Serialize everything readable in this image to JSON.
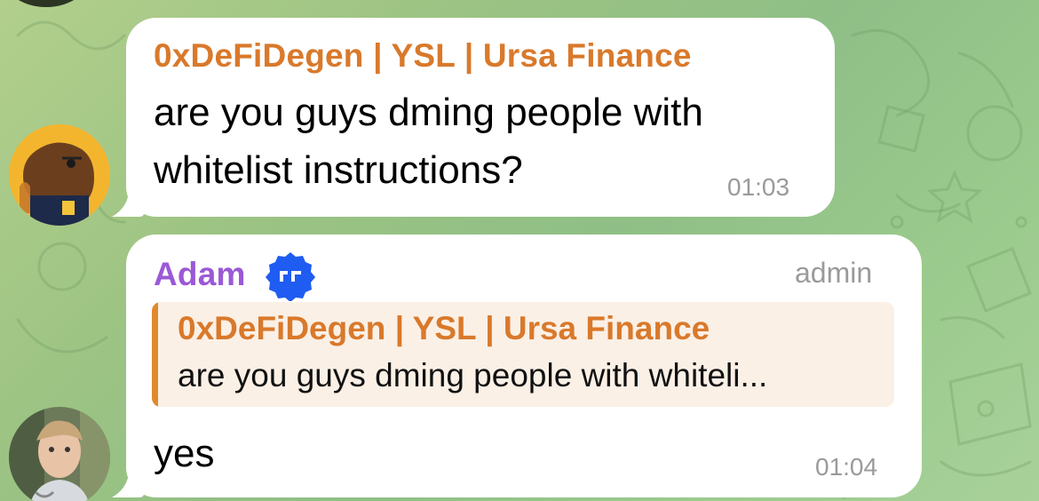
{
  "colors": {
    "sender_one_name": "#d9792b",
    "sender_two_name": "#9b59d6",
    "reply_bar": "#e08a2e",
    "verified_badge": "#1f5cf2",
    "timestamp": "#9a9a9a"
  },
  "messages": [
    {
      "sender": "0xDeFiDegen | YSL | Ursa Finance",
      "avatar_icon": "capybara-avatar-icon",
      "lines": [
        "are you guys dming people with",
        "whitelist instructions?"
      ],
      "time": "01:03"
    },
    {
      "sender": "Adam",
      "avatar_icon": "man-avatar-icon",
      "badge_icon": "verified-badge-icon",
      "role": "admin",
      "reply": {
        "sender": "0xDeFiDegen | YSL | Ursa Finance",
        "text": "are you guys dming people with whiteli..."
      },
      "text": "yes",
      "time": "01:04"
    }
  ]
}
